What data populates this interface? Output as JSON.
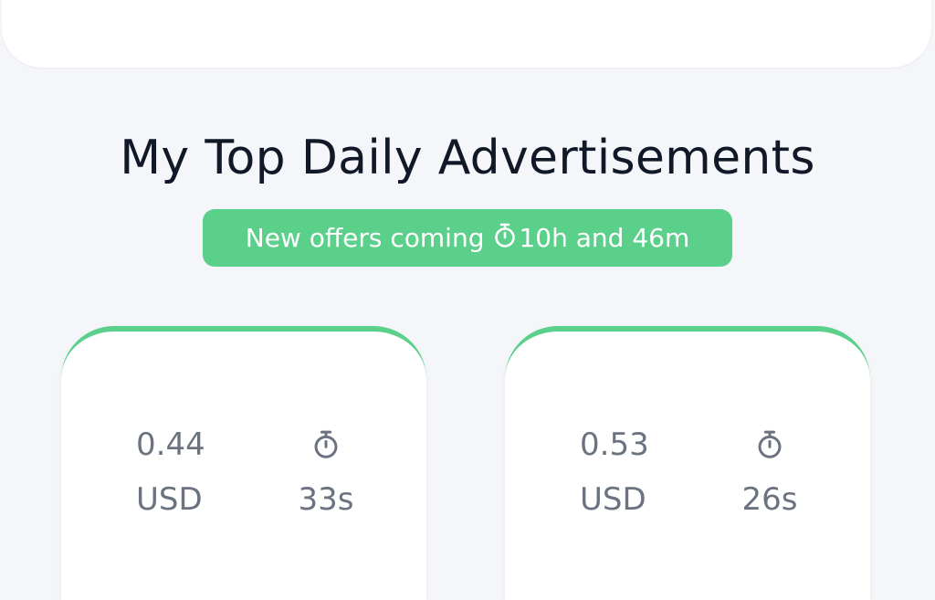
{
  "section": {
    "title": "My Top Daily Advertisements"
  },
  "offer_banner": {
    "prefix": "New offers coming",
    "countdown": "10h and 46m",
    "icon": "stopwatch-icon",
    "color": "#5bd08a"
  },
  "ads": [
    {
      "amount": "0.44",
      "currency": "USD",
      "duration": "33s",
      "icon": "stopwatch-icon"
    },
    {
      "amount": "0.53",
      "currency": "USD",
      "duration": "26s",
      "icon": "stopwatch-icon"
    }
  ],
  "colors": {
    "background": "#f4f6fa",
    "card": "#ffffff",
    "accent": "#5bd08a",
    "title_text": "#111827",
    "muted_text": "#6b7280"
  }
}
